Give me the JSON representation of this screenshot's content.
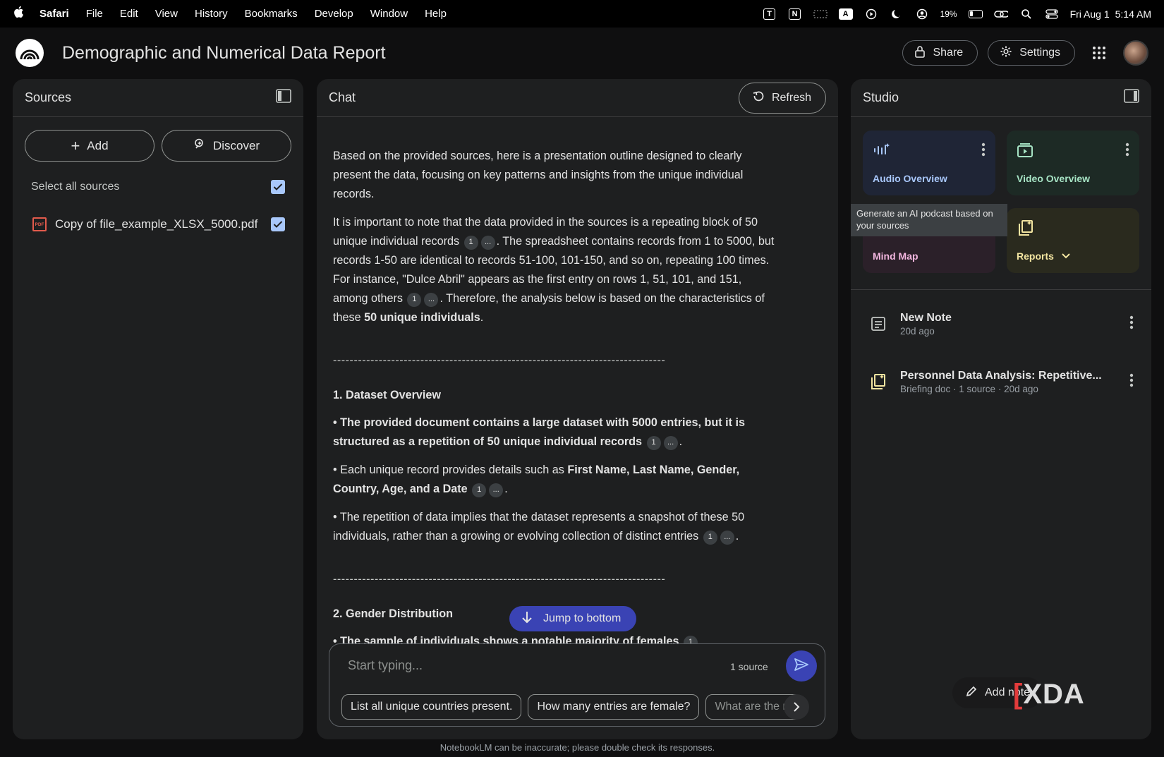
{
  "menubar": {
    "app": "Safari",
    "items": [
      "File",
      "Edit",
      "View",
      "History",
      "Bookmarks",
      "Develop",
      "Window",
      "Help"
    ],
    "battery": "19%",
    "date": "Fri Aug 1",
    "time": "5:14 AM"
  },
  "header": {
    "title": "Demographic and Numerical Data Report",
    "share_label": "Share",
    "settings_label": "Settings"
  },
  "sources": {
    "title": "Sources",
    "add_label": "Add",
    "discover_label": "Discover",
    "select_all_label": "Select all sources",
    "items": [
      {
        "name": "Copy of file_example_XLSX_5000.pdf",
        "icon_text": "PDF"
      }
    ]
  },
  "chat": {
    "title": "Chat",
    "refresh_label": "Refresh",
    "p1": "Based on the provided sources, here is a presentation outline designed to clearly present the data, focusing on key patterns and insights from the unique individual records.",
    "p2_a": "It is important to note that the data provided in the sources is a repeating block of 50 unique individual records",
    "p2_b": ". The spreadsheet contains records from 1 to 5000, but records 1-50 are identical to records 51-100, 101-150, and so on, repeating 100 times. For instance, \"Dulce Abril\" appears as the first entry on rows 1, 51, 101, and 151, among others",
    "p2_c": ". Therefore, the analysis below is based on the characteristics of these ",
    "p2_bold": "50 unique individuals",
    "p2_end": ".",
    "separator": "--------------------------------------------------------------------------------",
    "section1_title": "1. Dataset Overview",
    "b1": "• The provided document contains a large dataset with 5000 entries, but it is structured as a repetition of 50 unique individual records",
    "b2_a": "• Each unique record provides details such as ",
    "b2_bold": "First Name, Last Name, Gender, Country, Age, and a Date",
    "b3": "• The repetition of data implies that the dataset represents a snapshot of these 50 individuals, rather than a growing or evolving collection of distinct entries",
    "section2_title": "2. Gender Distribution",
    "b4": "• The sample of individuals shows a notable majority of females",
    "cite_num": "1",
    "cite_more": "...",
    "period": ".",
    "jump_label": "Jump to bottom",
    "input_placeholder": "Start typing...",
    "source_count": "1 source",
    "chips": [
      "List all unique countries present.",
      "How many entries are female?",
      "What are the m"
    ],
    "disclaimer": "NotebookLM can be inaccurate; please double check its responses."
  },
  "studio": {
    "title": "Studio",
    "tiles": [
      {
        "label": "Audio Overview",
        "color": "#a8c7fa"
      },
      {
        "label": "Video Overview",
        "color": "#a6e3c4"
      },
      {
        "label": "Mind Map",
        "color": "#f3b6df"
      },
      {
        "label": "Reports",
        "color": "#f3e5a1"
      }
    ],
    "tooltip": "Generate an AI podcast based on your sources",
    "notes": [
      {
        "title": "New Note",
        "meta": "20d ago"
      },
      {
        "title": "Personnel Data Analysis: Repetitive...",
        "meta": "Briefing doc · 1 source · 20d ago"
      }
    ],
    "add_note_label": "Add note",
    "watermark": "XDA"
  }
}
